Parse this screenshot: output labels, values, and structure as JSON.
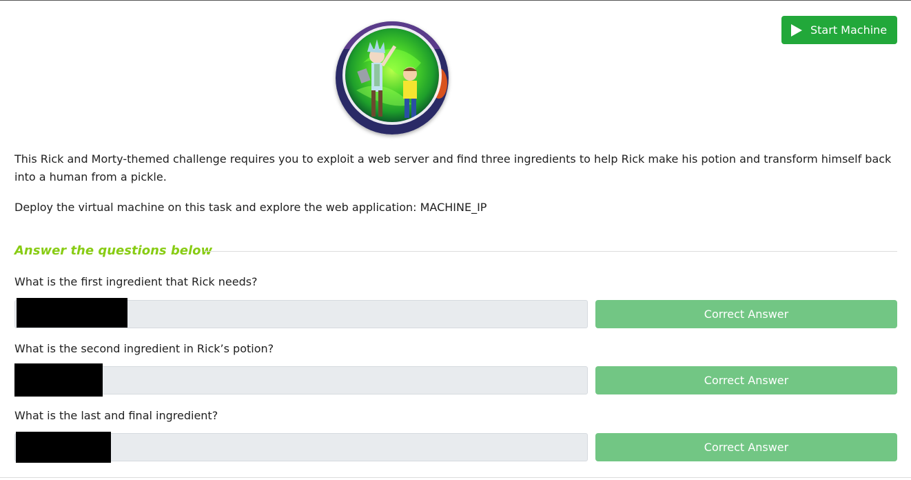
{
  "task": {
    "start_button_label": "Start Machine",
    "description_1": "This Rick and Morty-themed challenge requires you to exploit a web server and find three ingredients to help Rick make his potion and transform himself back into a human from a pickle.",
    "description_2": "Deploy the virtual machine on this task and explore the web application: MACHINE_IP"
  },
  "answers": {
    "heading": "Answer the questions below",
    "questions": [
      {
        "text": "What is the first ingredient that Rick needs?",
        "button_label": "Correct Answer"
      },
      {
        "text": "What is the second ingredient in Rick’s potion?",
        "button_label": "Correct Answer"
      },
      {
        "text": "What is the last and final ingredient?",
        "button_label": "Correct Answer"
      }
    ]
  },
  "colors": {
    "start_button": "#22a83a",
    "answer_heading": "#88cc14",
    "correct_button": "#72c684",
    "input_background": "#e8ebee"
  }
}
